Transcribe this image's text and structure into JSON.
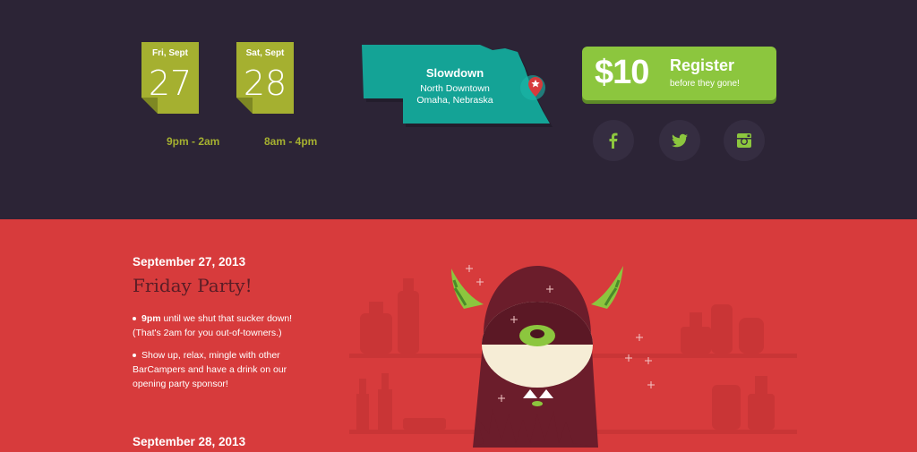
{
  "dates": [
    {
      "day": "Fri,  Sept",
      "number": "27",
      "time": "9pm - 2am"
    },
    {
      "day": "Sat,  Sept",
      "number": "28",
      "time": "8am - 4pm"
    }
  ],
  "venue": {
    "name": "Slowdown",
    "line1": "North Downtown",
    "line2": "Omaha, Nebraska"
  },
  "register": {
    "price": "$10",
    "label": "Register",
    "sublabel": "before they gone!"
  },
  "social": [
    "facebook-icon",
    "twitter-icon",
    "instagram-icon"
  ],
  "colors": {
    "dark_bg": "#2c2436",
    "red_bg": "#d73b3c",
    "note_green": "#a5b030",
    "register_green": "#8cc63e",
    "map_teal": "#14a396",
    "monster": "#6b1d2b"
  },
  "schedule": [
    {
      "date": "September 27, 2013",
      "title": "Friday Party!",
      "bullets": [
        {
          "strong": "9pm",
          "text": " until we shut that sucker down! (That's 2am for you out-of-towners.)"
        },
        {
          "strong": "",
          "text": "Show up, relax, mingle with other BarCampers and have a drink on our opening party sponsor!"
        }
      ]
    },
    {
      "date": "September 28, 2013"
    }
  ]
}
